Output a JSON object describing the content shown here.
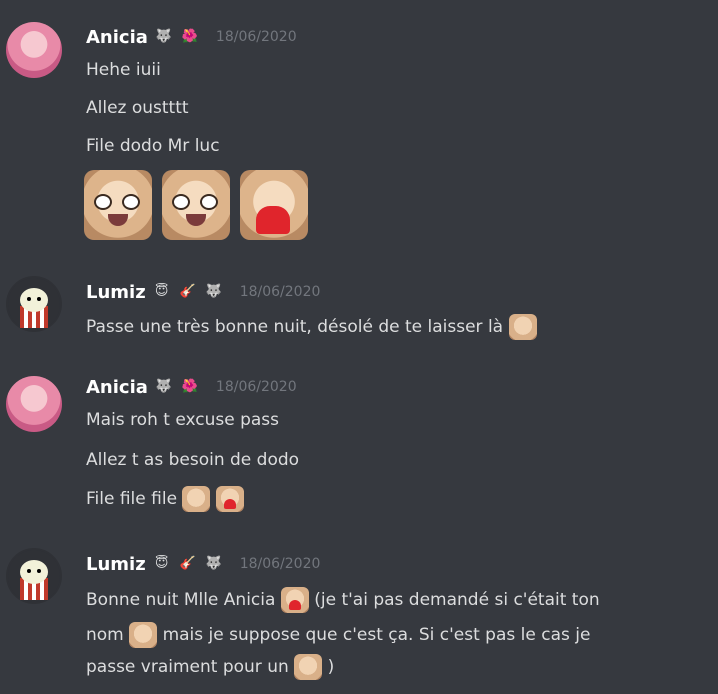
{
  "messages": [
    {
      "author": "Anicia",
      "timestamp": "18/06/2020",
      "lines": [
        "Hehe iuii",
        "Allez oustttt",
        "File dodo Mr luc"
      ]
    },
    {
      "author": "Lumiz",
      "timestamp": "18/06/2020",
      "lines": [
        "Passe une très bonne nuit, désolé de te laisser là"
      ]
    },
    {
      "author": "Anicia",
      "timestamp": "18/06/2020",
      "lines": [
        "Mais roh t excuse pass",
        "Allez t as besoin de dodo",
        "File file file"
      ]
    },
    {
      "author": "Lumiz",
      "timestamp": "18/06/2020",
      "lines": [
        "Bonne nuit Mlle Anicia",
        "(je t'ai pas demandé si c'était ton",
        "nom",
        "mais je suppose que c'est ça. Si c'est pas le cas je",
        "passe vraiment pour un",
        ")"
      ]
    }
  ],
  "badges": {
    "anicia": [
      "wolf-icon",
      "hibiscus-icon"
    ],
    "lumiz": [
      "halo-smile-icon",
      "guitar-icon",
      "wolf-icon"
    ]
  },
  "colors": {
    "background": "#36393f",
    "username": "#ffffff",
    "timestamp": "#72767d",
    "text": "#dcddde"
  }
}
